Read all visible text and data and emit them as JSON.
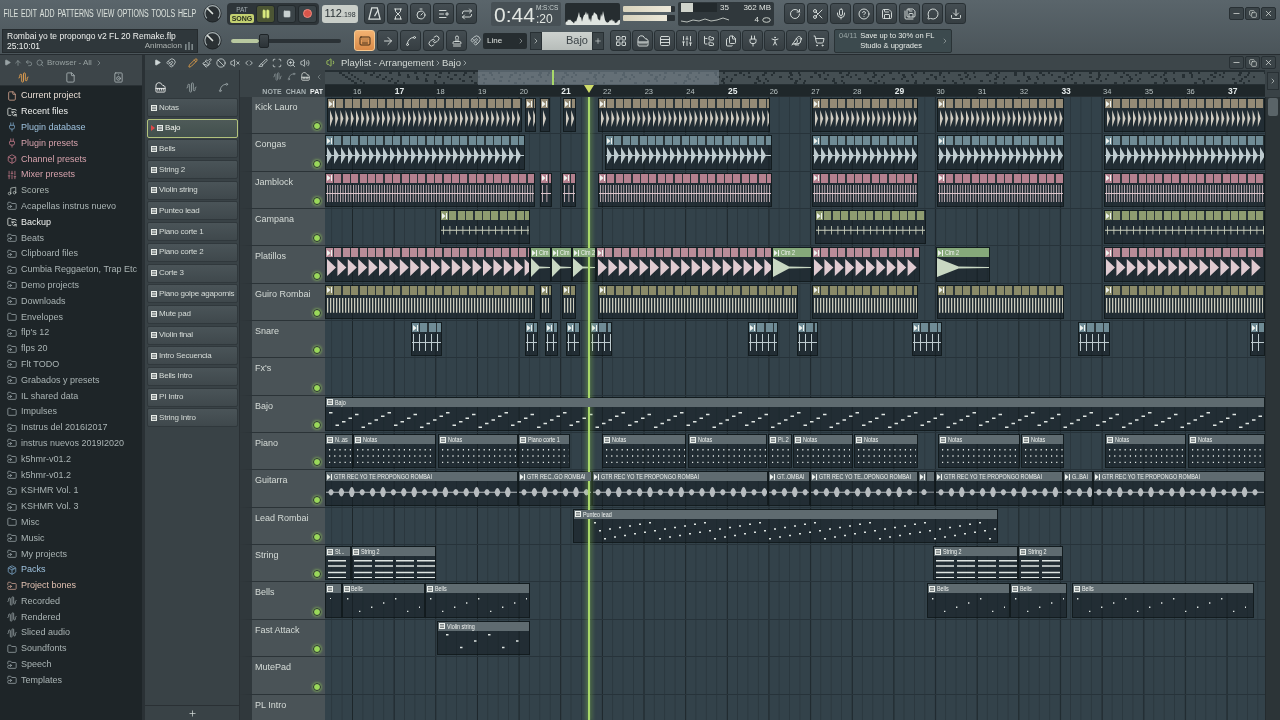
{
  "menu": [
    "FILE",
    "EDIT",
    "ADD",
    "PATTERNS",
    "VIEW",
    "OPTIONS",
    "TOOLS",
    "HELP"
  ],
  "transport": {
    "modes": [
      {
        "label": "PAT",
        "selected": false
      },
      {
        "label": "SONG",
        "selected": true
      }
    ],
    "playing": true,
    "tempo": "112",
    "tempo_decimals": ".198",
    "time": "0:44",
    "time_fraction": ":20",
    "time_format": "M:S:CS"
  },
  "output_meters": [
    {
      "level": 0.92
    },
    {
      "level": 0.84
    }
  ],
  "performance": {
    "cpu": {
      "level": 0.33,
      "reading": "35"
    },
    "memory": "362 MB",
    "polyphony": "4"
  },
  "hint_bar": {
    "project": "Rombai yo te propongo v2 FL 20 Remake.flp",
    "time": "25:10:01",
    "label": "Animacion"
  },
  "master_slider": {
    "level": 0.3
  },
  "record_tools": [
    {
      "on": true
    },
    {
      "on": false
    },
    {
      "on": false
    },
    {
      "on": false
    },
    {
      "on": false
    }
  ],
  "snap": "Line",
  "pattern_selector": "Bajo",
  "news": {
    "date": "04/11",
    "text": "Save up to 30% on FL Studio & upgrades"
  },
  "browser": {
    "title": "Browser - All",
    "tabs": [
      {
        "selected": true
      },
      {
        "selected": false
      },
      {
        "selected": false
      }
    ],
    "items": [
      {
        "label": "Current project",
        "kind": "project"
      },
      {
        "label": "Recent files",
        "kind": "recent"
      },
      {
        "label": "Plugin database",
        "kind": "plugin-db"
      },
      {
        "label": "Plugin presets",
        "kind": "plugin-presets"
      },
      {
        "label": "Channel presets",
        "kind": "channel-presets"
      },
      {
        "label": "Mixer presets",
        "kind": "mixer-presets"
      },
      {
        "label": "Scores",
        "kind": "scores"
      },
      {
        "label": "Acapellas instrus nuevo",
        "kind": "link-folder"
      },
      {
        "label": "Backup",
        "kind": "recent"
      },
      {
        "label": "Beats",
        "kind": "link-folder"
      },
      {
        "label": "Clipboard files",
        "kind": "link-folder"
      },
      {
        "label": "Cumbia Reggaeton, Trap Etc",
        "kind": "link-folder"
      },
      {
        "label": "Demo projects",
        "kind": "link-folder"
      },
      {
        "label": "Downloads",
        "kind": "link-folder"
      },
      {
        "label": "Envelopes",
        "kind": "folder"
      },
      {
        "label": "flp's 12",
        "kind": "link-folder"
      },
      {
        "label": "flps 20",
        "kind": "link-folder"
      },
      {
        "label": "Flt TODO",
        "kind": "link-folder"
      },
      {
        "label": "Grabados y presets",
        "kind": "link-folder"
      },
      {
        "label": "IL shared data",
        "kind": "link-folder"
      },
      {
        "label": "Impulses",
        "kind": "folder"
      },
      {
        "label": "Instrus del 2016I2017",
        "kind": "link-folder"
      },
      {
        "label": "instrus nuevos 2019I2020",
        "kind": "link-folder"
      },
      {
        "label": "k5hmr-v01.2",
        "kind": "link-folder"
      },
      {
        "label": "k5hmr-v01.2",
        "kind": "link-folder"
      },
      {
        "label": "KSHMR Vol. 1",
        "kind": "link-folder"
      },
      {
        "label": "KSHMR Vol. 3",
        "kind": "link-folder"
      },
      {
        "label": "Misc",
        "kind": "folder"
      },
      {
        "label": "Music",
        "kind": "link-folder"
      },
      {
        "label": "My projects",
        "kind": "link-folder"
      },
      {
        "label": "Packs",
        "kind": "packs"
      },
      {
        "label": "Project bones",
        "kind": "bones"
      },
      {
        "label": "Recorded",
        "kind": "audio"
      },
      {
        "label": "Rendered",
        "kind": "audio"
      },
      {
        "label": "Sliced audio",
        "kind": "audio"
      },
      {
        "label": "Soundfonts",
        "kind": "folder"
      },
      {
        "label": "Speech",
        "kind": "link-folder"
      },
      {
        "label": "Templates",
        "kind": "link-folder"
      }
    ]
  },
  "pattern_picker": {
    "tabs": [
      {
        "selected": true
      },
      {
        "selected": false
      },
      {
        "selected": false
      }
    ],
    "items": [
      {
        "label": "Notas",
        "selected": false
      },
      {
        "label": "Bajo",
        "selected": true
      },
      {
        "label": "Bells",
        "selected": false
      },
      {
        "label": "String 2",
        "selected": false
      },
      {
        "label": "Violin string",
        "selected": false
      },
      {
        "label": "Punteo lead",
        "selected": false
      },
      {
        "label": "Piano corte 1",
        "selected": false
      },
      {
        "label": "Piano corte 2",
        "selected": false
      },
      {
        "label": "Corte 3",
        "selected": false
      },
      {
        "label": "Piano golpe agapornis",
        "selected": false
      },
      {
        "label": "Mute pad",
        "selected": false
      },
      {
        "label": "Violin final",
        "selected": false
      },
      {
        "label": "Intro Secuencia",
        "selected": false
      },
      {
        "label": "Bells Intro",
        "selected": false
      },
      {
        "label": "PI Intro",
        "selected": false
      },
      {
        "label": "String Intro",
        "selected": false
      }
    ]
  },
  "playlist": {
    "title": "Playlist - Arrangement",
    "pattern": "Bajo",
    "tools": [
      {
        "selected": true
      },
      {
        "selected": false
      },
      {
        "selected": false
      },
      {
        "selected": false
      },
      {
        "selected": false
      },
      {
        "selected": false
      },
      {
        "selected": false
      },
      {
        "selected": false
      },
      {
        "selected": false
      }
    ],
    "view_tabs": [
      {
        "label": "NOTE",
        "selected": false
      },
      {
        "label": "CHAN",
        "selected": false
      },
      {
        "label": "PAT",
        "selected": true
      }
    ],
    "ruler": [
      "16",
      "17",
      "18",
      "19",
      "20",
      "21",
      "22",
      "23",
      "24",
      "25",
      "26",
      "27",
      "28",
      "29",
      "30",
      "31",
      "32",
      "33",
      "34",
      "35",
      "36",
      "37"
    ],
    "position_marker": {
      "level": 0.281
    },
    "tracks": [
      {
        "name": "Kick Lauro",
        "on": true,
        "clips": [
          {
            "kind": "audio",
            "color": "#958b76"
          },
          {
            "kind": "audio",
            "color": "#958b76"
          },
          {
            "kind": "audio",
            "color": "#958b76"
          },
          {
            "kind": "audio",
            "color": "#958b76"
          },
          {
            "kind": "audio",
            "color": "#958b76"
          },
          {
            "kind": "audio",
            "color": "#958b76"
          },
          {
            "kind": "audio",
            "color": "#958b76"
          },
          {
            "kind": "audio",
            "color": "#958b76"
          }
        ]
      },
      {
        "name": "Congas",
        "on": true,
        "clips": [
          {
            "kind": "audio",
            "color": "#6f8b95"
          },
          {
            "kind": "audio",
            "color": "#6f8b95"
          },
          {
            "kind": "audio",
            "color": "#6f8b95"
          },
          {
            "kind": "audio",
            "color": "#6f8b95"
          },
          {
            "kind": "audio",
            "color": "#6f8b95"
          }
        ]
      },
      {
        "name": "Jamblock",
        "on": true,
        "clips": [
          {
            "kind": "audio",
            "color": "#b3808e"
          },
          {
            "kind": "audio",
            "color": "#b3808e"
          },
          {
            "kind": "audio",
            "color": "#b3808e"
          },
          {
            "kind": "audio",
            "color": "#b3808e"
          },
          {
            "kind": "audio",
            "color": "#b3808e"
          },
          {
            "kind": "audio",
            "color": "#b3808e"
          },
          {
            "kind": "audio",
            "color": "#b3808e"
          }
        ]
      },
      {
        "name": "Campana",
        "on": true,
        "clips": [
          {
            "kind": "audio",
            "color": "#8f9c70"
          },
          {
            "kind": "audio",
            "color": "#8f9c70"
          },
          {
            "kind": "audio",
            "color": "#8f9c70"
          }
        ]
      },
      {
        "name": "Platillos",
        "on": true,
        "clips": [
          {
            "kind": "audio",
            "color": "#b98c98"
          },
          {
            "kind": "audio",
            "label": "Cim",
            "color": "#86a97a"
          },
          {
            "kind": "audio",
            "label": "Cim",
            "color": "#86a97a"
          },
          {
            "kind": "audio",
            "label": "Cim 2",
            "color": "#86a97a"
          },
          {
            "kind": "audio",
            "color": "#b98c98"
          },
          {
            "kind": "audio",
            "label": "Cim 2",
            "color": "#86a97a"
          },
          {
            "kind": "audio",
            "color": "#b98c98"
          },
          {
            "kind": "audio",
            "label": "Cim 2",
            "color": "#86a97a"
          },
          {
            "kind": "audio",
            "color": "#b98c98"
          }
        ]
      },
      {
        "name": "Guiro Rombai",
        "on": true,
        "clips": [
          {
            "kind": "audio",
            "color": "#8a8a68"
          },
          {
            "kind": "audio",
            "color": "#8a8a68"
          },
          {
            "kind": "audio",
            "color": "#8a8a68"
          },
          {
            "kind": "audio",
            "color": "#8a8a68"
          },
          {
            "kind": "audio",
            "color": "#8a8a68"
          },
          {
            "kind": "audio",
            "color": "#8a8a68"
          },
          {
            "kind": "audio",
            "color": "#8a8a68"
          }
        ]
      },
      {
        "name": "Snare",
        "on": true,
        "clips": [
          {
            "kind": "audio",
            "color": "#6f8b95"
          },
          {
            "kind": "audio",
            "color": "#6f8b95"
          },
          {
            "kind": "audio",
            "color": "#6f8b95"
          },
          {
            "kind": "audio",
            "color": "#6f8b95"
          },
          {
            "kind": "audio",
            "color": "#6f8b95"
          },
          {
            "kind": "audio",
            "color": "#6f8b95"
          },
          {
            "kind": "audio",
            "color": "#6f8b95"
          },
          {
            "kind": "audio",
            "color": "#6f8b95"
          },
          {
            "kind": "audio",
            "color": "#6f8b95"
          },
          {
            "kind": "audio",
            "color": "#6f8b95"
          }
        ]
      },
      {
        "name": "Fx's",
        "on": true
      },
      {
        "name": "Bajo",
        "on": true,
        "clips": [
          {
            "kind": "pattern",
            "label": "Bajo",
            "color": "#5f6b70"
          }
        ]
      },
      {
        "name": "Piano",
        "on": true,
        "clips": [
          {
            "kind": "pattern",
            "label": "N..as",
            "color": "#5f6b70"
          },
          {
            "kind": "pattern",
            "label": "Notas",
            "color": "#5f6b70"
          },
          {
            "kind": "pattern",
            "label": "Notas",
            "color": "#5f6b70"
          },
          {
            "kind": "pattern",
            "label": "Piano corte 1",
            "color": "#5f6b70"
          },
          {
            "kind": "pattern",
            "label": "Notas",
            "color": "#5f6b70"
          },
          {
            "kind": "pattern",
            "label": "Notas",
            "color": "#5f6b70"
          },
          {
            "kind": "pattern",
            "label": "Pi..2",
            "color": "#5f6b70"
          },
          {
            "kind": "pattern",
            "label": "Notas",
            "color": "#5f6b70"
          },
          {
            "kind": "pattern",
            "label": "Notas",
            "color": "#5f6b70"
          },
          {
            "kind": "pattern",
            "label": "Notas",
            "color": "#5f6b70"
          },
          {
            "kind": "pattern",
            "label": "Notas",
            "color": "#5f6b70"
          },
          {
            "kind": "pattern",
            "label": "Notas",
            "color": "#5f6b70"
          },
          {
            "kind": "pattern",
            "label": "Notas",
            "color": "#5f6b70"
          }
        ]
      },
      {
        "name": "Guitarra",
        "on": true,
        "clips": [
          {
            "kind": "audio",
            "label": "GTR REC YO TE PROPONGO ROMBAI",
            "color": "#5f6b70"
          },
          {
            "kind": "audio",
            "label": "GTR REC..GO ROMBAI",
            "color": "#5f6b70"
          },
          {
            "kind": "audio",
            "label": "GTR REC YO TE PROPONGO ROMBAI",
            "color": "#5f6b70"
          },
          {
            "kind": "audio",
            "label": "GT..OMBAI",
            "color": "#5f6b70"
          },
          {
            "kind": "audio",
            "label": "GTR REC YO TE..OPONGO ROMBAI",
            "color": "#5f6b70"
          },
          {
            "kind": "audio",
            "color": "#5f6b70"
          },
          {
            "kind": "audio",
            "label": "GTR REC YO TE PROPONGO ROMBAI",
            "color": "#5f6b70"
          },
          {
            "kind": "audio",
            "label": "G..BAI",
            "color": "#5f6b70"
          },
          {
            "kind": "audio",
            "label": "GTR REC YO TE PROPONGO ROMBAI",
            "color": "#5f6b70"
          }
        ]
      },
      {
        "name": "Lead Rombai",
        "on": true,
        "clips": [
          {
            "kind": "pattern",
            "label": "Punteo lead",
            "color": "#5f6b70"
          }
        ]
      },
      {
        "name": "String",
        "on": true,
        "clips": [
          {
            "kind": "pattern",
            "label": "St...",
            "color": "#5f6b70"
          },
          {
            "kind": "pattern",
            "label": "String 2",
            "color": "#5f6b70"
          },
          {
            "kind": "pattern",
            "label": "String 2",
            "color": "#5f6b70"
          },
          {
            "kind": "pattern",
            "label": "String 2",
            "color": "#5f6b70"
          }
        ]
      },
      {
        "name": "Bells",
        "on": true,
        "clips": [
          {
            "kind": "pattern",
            "color": "#5f6b70"
          },
          {
            "kind": "pattern",
            "label": "Bells",
            "color": "#5f6b70"
          },
          {
            "kind": "pattern",
            "label": "Bells",
            "color": "#5f6b70"
          },
          {
            "kind": "pattern",
            "label": "Bells",
            "color": "#5f6b70"
          },
          {
            "kind": "pattern",
            "label": "Bells",
            "color": "#5f6b70"
          },
          {
            "kind": "pattern",
            "label": "Bells",
            "color": "#5f6b70"
          }
        ]
      },
      {
        "name": "Fast Attack",
        "on": true,
        "clips": [
          {
            "kind": "pattern",
            "label": "Violin string",
            "color": "#5f6b70"
          }
        ]
      },
      {
        "name": "MutePad",
        "on": true
      },
      {
        "name": "PL Intro"
      }
    ]
  }
}
